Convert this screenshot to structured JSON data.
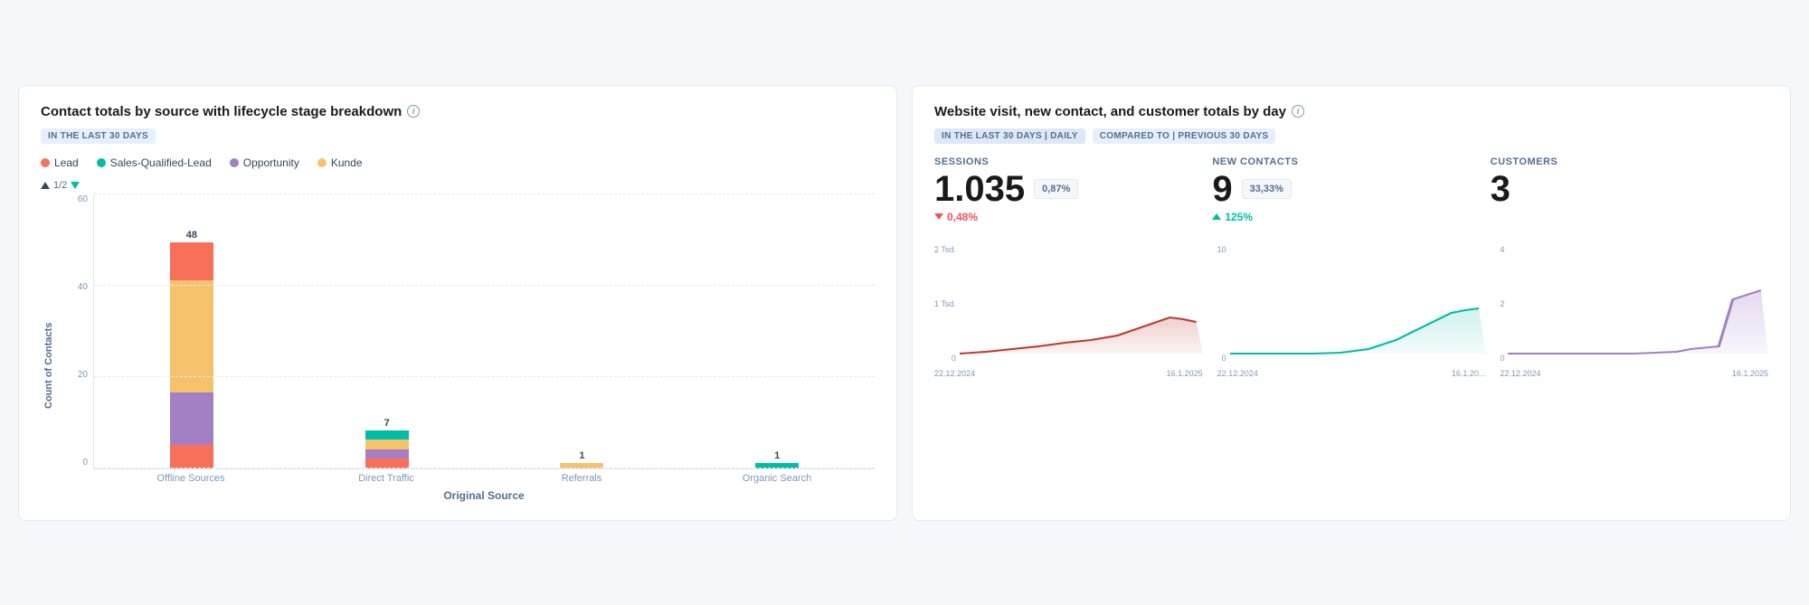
{
  "left_card": {
    "title": "Contact totals by source with lifecycle stage breakdown",
    "filter": "IN THE LAST 30 DAYS",
    "legend": [
      {
        "label": "Lead",
        "color": "#f97059"
      },
      {
        "label": "Sales-Qualified-Lead",
        "color": "#00bda5"
      },
      {
        "label": "Opportunity",
        "color": "#a37fc4"
      },
      {
        "label": "Kunde",
        "color": "#f5c26b"
      }
    ],
    "pagination": "1/2",
    "y_axis_label": "Count of Contacts",
    "x_axis_label": "Original Source",
    "y_ticks": [
      "0",
      "20",
      "40",
      "60"
    ],
    "bars": [
      {
        "label": "Offline Sources",
        "total": "48",
        "segments": [
          {
            "color": "#f97059",
            "height_pct": 10,
            "value": 5
          },
          {
            "color": "#a37fc4",
            "height_pct": 22,
            "value": 11
          },
          {
            "color": "#f5c26b",
            "height_pct": 48,
            "value": 24
          },
          {
            "color": "#f97059",
            "height_pct": 16,
            "value": 8
          }
        ]
      },
      {
        "label": "Direct Traffic",
        "total": "7",
        "segments": [
          {
            "color": "#f97059",
            "height_pct": 4,
            "value": 2
          },
          {
            "color": "#a37fc4",
            "height_pct": 4,
            "value": 2
          },
          {
            "color": "#f5c26b",
            "height_pct": 4,
            "value": 2
          },
          {
            "color": "#00bda5",
            "height_pct": 4,
            "value": 1
          }
        ]
      },
      {
        "label": "Referrals",
        "total": "1",
        "segments": [
          {
            "color": "#f5c26b",
            "height_pct": 2,
            "value": 1
          }
        ]
      },
      {
        "label": "Organic Search",
        "total": "1",
        "segments": [
          {
            "color": "#00bda5",
            "height_pct": 2,
            "value": 1
          }
        ]
      }
    ]
  },
  "right_card": {
    "title": "Website visit, new contact, and customer totals by day",
    "filters": [
      {
        "label": "IN THE LAST 30 DAYS | DAILY",
        "active": true
      },
      {
        "label": "COMPARED TO | PREVIOUS 30 DAYS",
        "active": false
      }
    ],
    "metrics": [
      {
        "label": "SESSIONS",
        "value": "1.035",
        "badge": "0,87%",
        "change_dir": "down",
        "change_val": "0,48%"
      },
      {
        "label": "NEW CONTACTS",
        "value": "9",
        "badge": "33,33%",
        "change_dir": "up",
        "change_val": "125%"
      },
      {
        "label": "CUSTOMERS",
        "value": "3",
        "badge": null,
        "change_dir": null,
        "change_val": null
      }
    ],
    "charts": [
      {
        "y_labels": [
          "2 Tsd.",
          "1 Tsd.",
          "0"
        ],
        "x_labels": [
          "22.12.2024",
          "16.1.2025"
        ],
        "color_line": "#c0392b",
        "color_fill": "#e8c5c0"
      },
      {
        "y_labels": [
          "10",
          "0"
        ],
        "x_labels": [
          "22.12.2024",
          "16.1.20..."
        ],
        "color_line": "#00bda5",
        "color_fill": "#c5ede9"
      },
      {
        "y_labels": [
          "4",
          "2",
          "0"
        ],
        "x_labels": [
          "22.12.2024",
          "16.1.2025"
        ],
        "color_line": "#a37fc4",
        "color_fill": "#ddd0ec"
      }
    ]
  }
}
